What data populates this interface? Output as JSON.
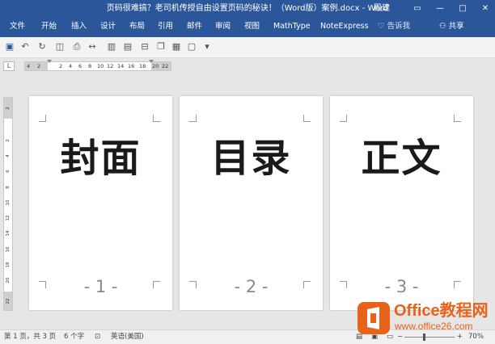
{
  "window": {
    "title": "页码很难搞？老司机传授自由设置页码的秘诀！（Word版）案例.docx - Word",
    "user": "殿建",
    "controls": [
      "ribbon-display-icon",
      "minimize-icon",
      "maximize-icon",
      "close-icon"
    ]
  },
  "ribbon": {
    "tabs": [
      "文件",
      "开始",
      "插入",
      "设计",
      "布局",
      "引用",
      "邮件",
      "审阅",
      "视图",
      "MathType",
      "NoteExpress"
    ],
    "tell_me": "告诉我",
    "share": "共享"
  },
  "quick_access": [
    "save-icon",
    "undo-icon",
    "redo-icon",
    "two-pages-icon",
    "print-preview-icon",
    "page-width-icon",
    "columns-icon",
    "insert-page-icon",
    "page-break-icon",
    "copy-format-icon",
    "multiple-pages-icon",
    "customize-icon"
  ],
  "ruler": {
    "corner": "L",
    "numbers": [
      "4",
      "2",
      "2",
      "4",
      "6",
      "8",
      "10",
      "12",
      "14",
      "16",
      "18",
      "20",
      "22"
    ],
    "vertical_numbers": [
      "2",
      "2",
      "4",
      "6",
      "8",
      "10",
      "12",
      "14",
      "16",
      "18",
      "20",
      "22"
    ]
  },
  "pages": [
    {
      "heading": "封面",
      "page_number": "- 1 -"
    },
    {
      "heading": "目录",
      "page_number": "- 2 -"
    },
    {
      "heading": "正文",
      "page_number": "- 3 -"
    }
  ],
  "status": {
    "page": "第 1 页，共 3 页",
    "words": "6 个字",
    "language": "英语(美国)",
    "zoom": "70%",
    "zoom_level_fraction": 0.4
  },
  "logo": {
    "name": "Office教程网",
    "url": "www.office26.com"
  }
}
